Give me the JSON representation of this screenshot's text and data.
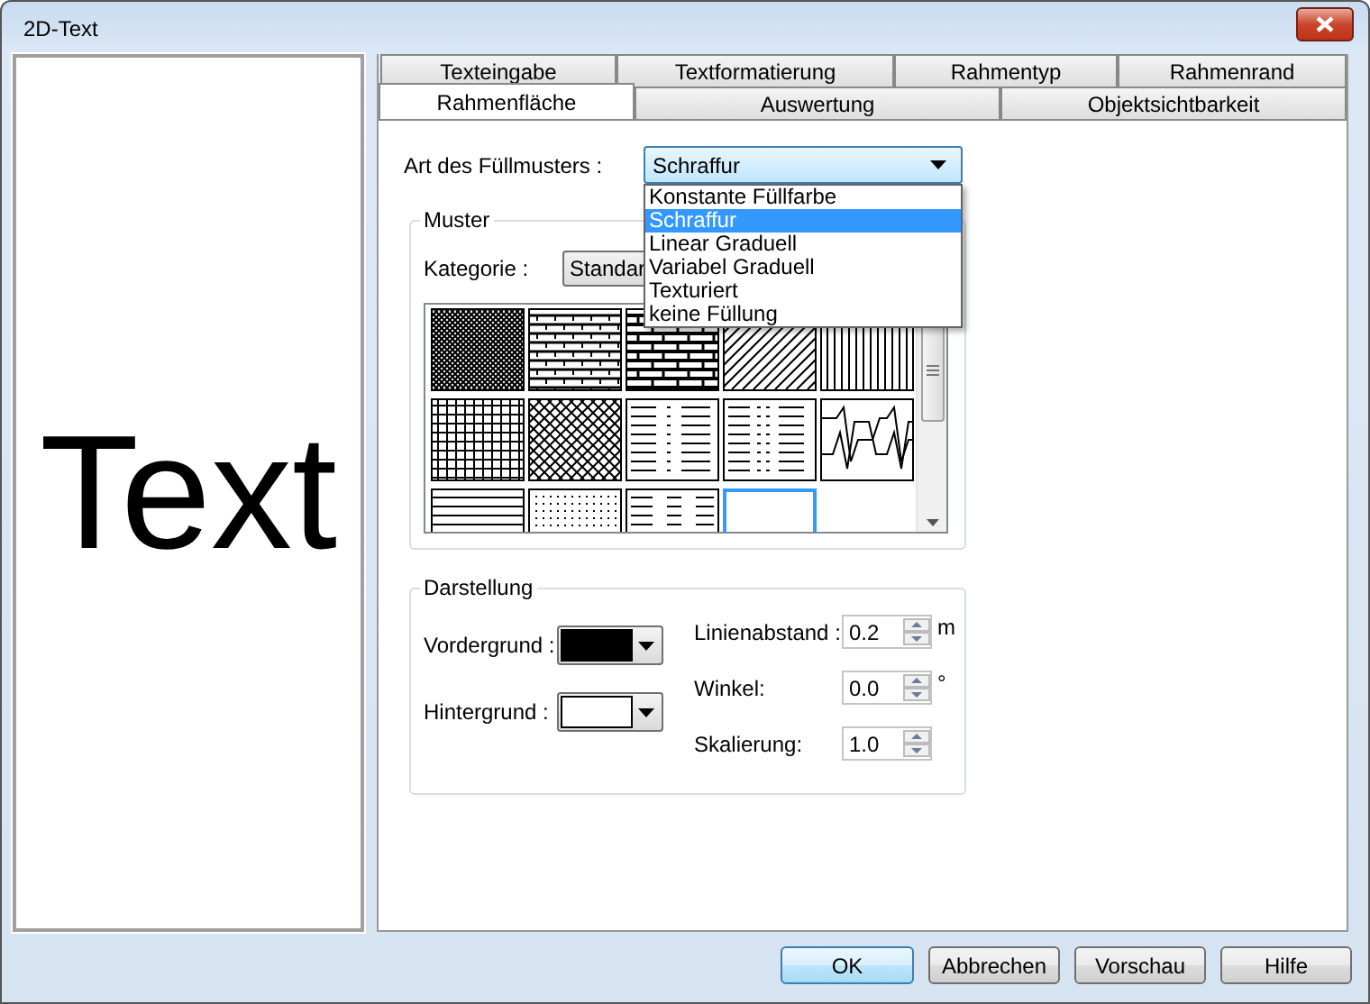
{
  "window": {
    "title": "2D-Text"
  },
  "preview": {
    "text": "Text"
  },
  "tab_rows": [
    [
      {
        "label": "Texteingabe",
        "selected": false
      },
      {
        "label": "Textformatierung",
        "selected": false
      },
      {
        "label": "Rahmentyp",
        "selected": false
      },
      {
        "label": "Rahmenrand",
        "selected": false
      }
    ],
    [
      {
        "label": "Rahmenfläche",
        "selected": true
      },
      {
        "label": "Auswertung",
        "selected": false
      },
      {
        "label": "Objektsichtbarkeit",
        "selected": false
      }
    ]
  ],
  "fill_type": {
    "label": "Art des Füllmusters :",
    "value": "Schraffur",
    "expanded": true,
    "options": [
      {
        "label": "Konstante Füllfarbe",
        "selected": false
      },
      {
        "label": "Schraffur",
        "selected": true
      },
      {
        "label": "Linear Graduell",
        "selected": false
      },
      {
        "label": "Variabel Graduell",
        "selected": false
      },
      {
        "label": "Texturiert",
        "selected": false
      },
      {
        "label": "keine Füllung",
        "selected": false
      }
    ]
  },
  "pattern_group": {
    "title": "Muster",
    "category_label": "Kategorie :",
    "category_value": "Standar",
    "patterns": [
      {
        "kind": "crosshatch",
        "selected": false
      },
      {
        "kind": "brick",
        "selected": false
      },
      {
        "kind": "heavybrick",
        "selected": false
      },
      {
        "kind": "diagonal",
        "selected": false
      },
      {
        "kind": "vertical",
        "selected": false
      },
      {
        "kind": "grid",
        "selected": false
      },
      {
        "kind": "diamond",
        "selected": false
      },
      {
        "kind": "dashdot",
        "selected": false
      },
      {
        "kind": "dashdot2",
        "selected": false
      },
      {
        "kind": "zigzag",
        "selected": false
      },
      {
        "kind": "horizontal",
        "selected": false
      },
      {
        "kind": "dots",
        "selected": false
      },
      {
        "kind": "dashes",
        "selected": false
      },
      {
        "kind": "blank",
        "selected": true
      }
    ]
  },
  "display_group": {
    "title": "Darstellung",
    "colors": [
      {
        "label": "Vordergrund :",
        "color": "#000000"
      },
      {
        "label": "Hintergrund :",
        "color": "#ffffff"
      }
    ],
    "spinners": [
      {
        "label": "Linienabstand :",
        "value": "0.2",
        "unit": "m"
      },
      {
        "label": "Winkel:",
        "value": "0.0",
        "unit": "°"
      },
      {
        "label": "Skalierung:",
        "value": "1.0"
      }
    ]
  },
  "buttons": [
    {
      "label": "OK",
      "default": true
    },
    {
      "label": "Abbrechen",
      "default": false
    },
    {
      "label": "Vorschau",
      "default": false
    },
    {
      "label": "Hilfe",
      "default": false
    }
  ]
}
